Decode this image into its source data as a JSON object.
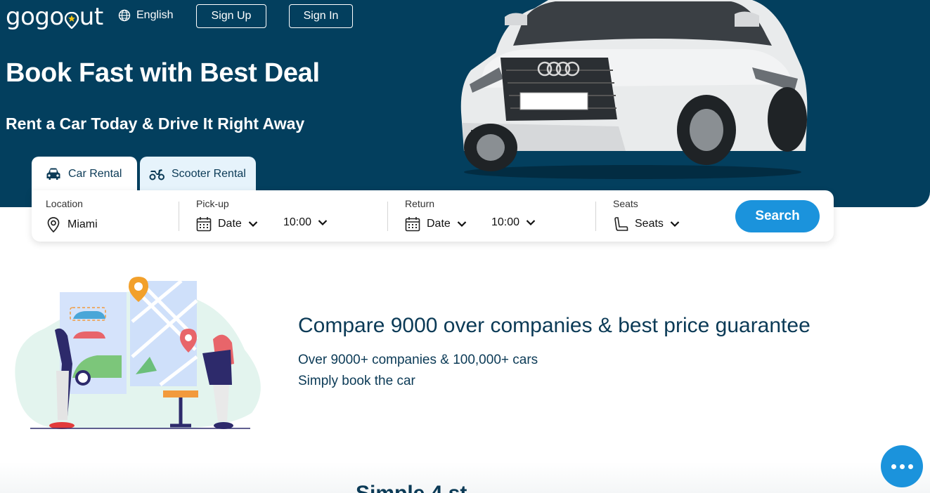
{
  "brand": {
    "logo_prefix": "gogo",
    "logo_suffix": "ut"
  },
  "header": {
    "language_label": "English",
    "signup_label": "Sign Up",
    "signin_label": "Sign In"
  },
  "hero": {
    "title": "Book Fast with Best Deal",
    "subtitle": "Rent a Car Today & Drive It Right Away"
  },
  "tabs": [
    {
      "label": "Car Rental",
      "icon": "car-icon",
      "active": true
    },
    {
      "label": "Scooter Rental",
      "icon": "scooter-icon",
      "active": false
    }
  ],
  "search": {
    "location": {
      "label": "Location",
      "value": "Miami",
      "icon": "location-pin-icon"
    },
    "pickup": {
      "label": "Pick-up",
      "date": "Date",
      "time": "10:00",
      "icon": "calendar-icon"
    },
    "return": {
      "label": "Return",
      "date": "Date",
      "time": "10:00",
      "icon": "calendar-icon"
    },
    "seats": {
      "label": "Seats",
      "value": "Seats",
      "icon": "seat-icon"
    },
    "button_label": "Search"
  },
  "compare": {
    "title": "Compare 9000 over companies & best price guarantee",
    "line1": "Over 9000+ companies & 100,000+ cars",
    "line2": "Simply book the car"
  },
  "next_section": {
    "title_partial": "Simple 4 st"
  },
  "colors": {
    "hero_bg": "#033f5e",
    "accent": "#1b93dc",
    "text_dark": "#0b3a56",
    "tab_inactive": "#e6f3fb"
  }
}
